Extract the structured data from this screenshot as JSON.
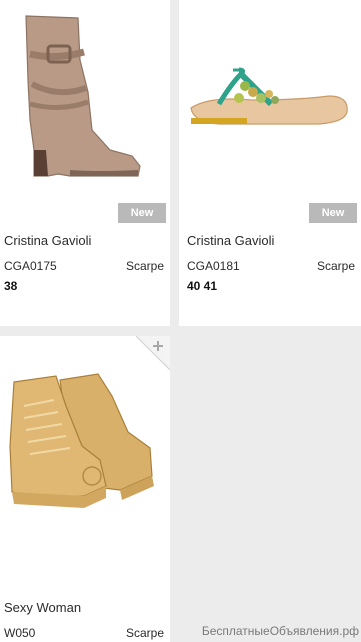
{
  "products": [
    {
      "brand": "Cristina Gavioli",
      "code": "CGA0175",
      "category": "Scarpe",
      "sizes": "38",
      "badge": "New",
      "image_icon": "boot-image"
    },
    {
      "brand": "Cristina Gavioli",
      "code": "CGA0181",
      "category": "Scarpe",
      "sizes": "40 41",
      "badge": "New",
      "image_icon": "sandal-image"
    },
    {
      "brand": "Sexy Woman",
      "code": "W050",
      "category": "Scarpe",
      "image_icon": "sneaker-image"
    }
  ],
  "corner_icon": "plus-icon",
  "watermark": "БесплатныеОбъявления.рф",
  "colors": {
    "background": "#ececec",
    "card": "#ffffff",
    "badge": "#b9b9b9"
  }
}
